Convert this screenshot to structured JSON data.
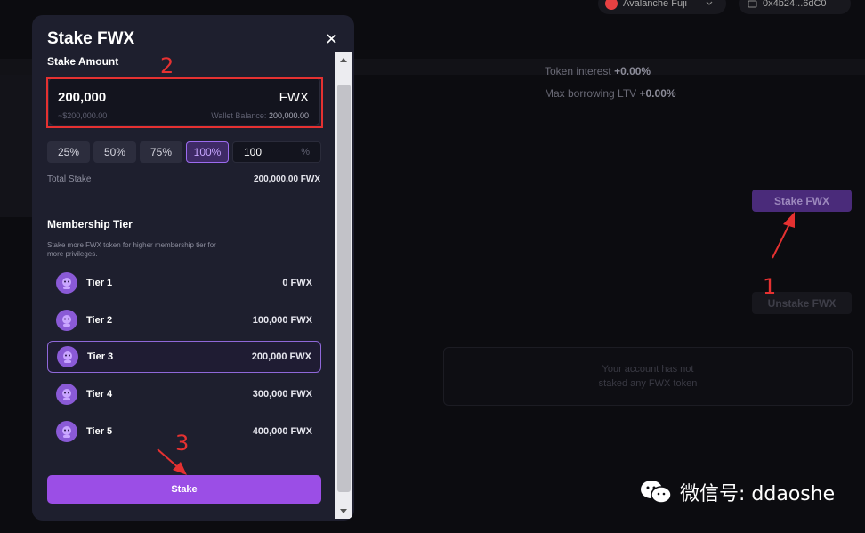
{
  "background": {
    "network": "Avalanche Fuji",
    "wallet": "0x4b24...6dC0",
    "token_interest_label": "Token interest",
    "token_interest_value": "+0.00%",
    "max_ltv_label": "Max borrowing LTV",
    "max_ltv_value": "+0.00%",
    "stake_button": "Stake FWX",
    "unstake_button": "Unstake FWX",
    "empty_line1": "Your account has not",
    "empty_line2": "staked any FWX token"
  },
  "modal": {
    "title": "Stake FWX",
    "stake_amount_label": "Stake Amount",
    "amount": "200,000",
    "token": "FWX",
    "usd_value": "~$200,000.00",
    "wallet_balance_label": "Wallet Balance:",
    "wallet_balance_value": "200,000.00",
    "percent_buttons": [
      "25%",
      "50%",
      "75%",
      "100%"
    ],
    "selected_percent": "100%",
    "percent_input": "100",
    "percent_symbol": "%",
    "total_stake_label": "Total Stake",
    "total_stake_value": "200,000.00 FWX",
    "membership_title": "Membership Tier",
    "membership_desc": "Stake more FWX token for higher membership tier for more privileges.",
    "tiers": [
      {
        "name": "Tier 1",
        "amount": "0 FWX"
      },
      {
        "name": "Tier 2",
        "amount": "100,000 FWX"
      },
      {
        "name": "Tier 3",
        "amount": "200,000 FWX"
      },
      {
        "name": "Tier 4",
        "amount": "300,000 FWX"
      },
      {
        "name": "Tier 5",
        "amount": "400,000 FWX"
      }
    ],
    "selected_tier": "Tier 3",
    "stake_button": "Stake"
  },
  "annotations": {
    "step1": "1",
    "step2": "2",
    "step3": "3",
    "color": "#e53131"
  },
  "watermark": {
    "text": "微信号: ddaoshe",
    "icon": "wechat-icon"
  },
  "colors": {
    "accent": "#9b4ee6",
    "modal_bg": "#1e1f2e",
    "page_bg": "#0c0c10"
  }
}
